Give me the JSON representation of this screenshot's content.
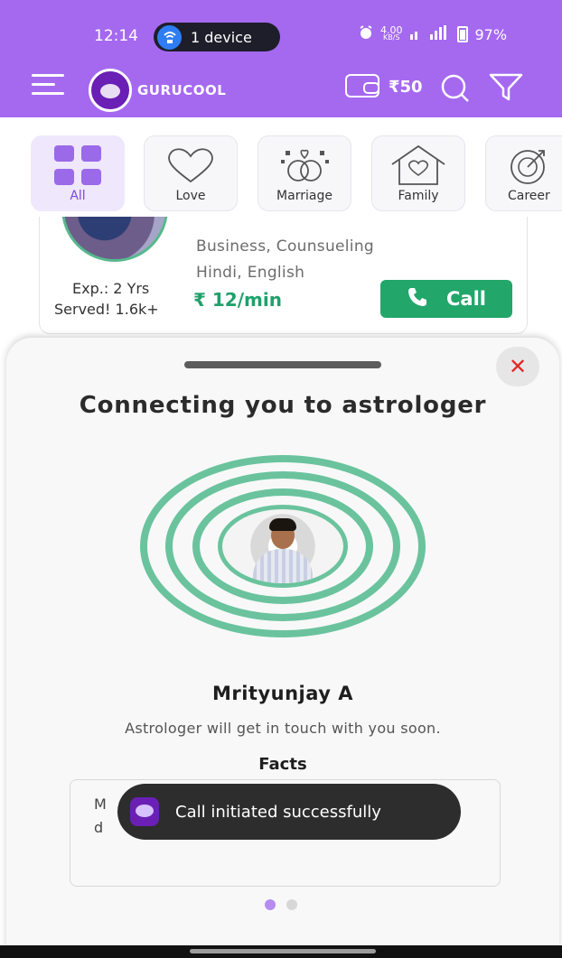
{
  "status": {
    "time": "12:14",
    "device_label": "1 device",
    "net_speed_top": "4.00",
    "net_speed_unit": "KB/S",
    "battery": "97%"
  },
  "appbar": {
    "brand": "GURUCOOL",
    "balance": "₹50"
  },
  "categories": [
    {
      "label": "All",
      "icon": "grid-icon",
      "active": true
    },
    {
      "label": "Love",
      "icon": "heart-icon"
    },
    {
      "label": "Marriage",
      "icon": "rings-icon"
    },
    {
      "label": "Family",
      "icon": "house-icon"
    },
    {
      "label": "Career",
      "icon": "career-icon"
    }
  ],
  "astrologer_card": {
    "skills": "Business, Counsueling",
    "languages": "Hindi, English",
    "experience": "Exp.: 2 Yrs",
    "served": "Served! 1.6k+",
    "price": "₹ 12/min",
    "call_label": "Call"
  },
  "sheet": {
    "title": "Connecting you to astrologer",
    "astrologer_name": "Mrityunjay A",
    "subtitle": "Astrologer will get in touch with you soon.",
    "facts_heading": "Facts",
    "facts_text_visible": "M\nd"
  },
  "toast": {
    "message": "Call initiated successfully"
  },
  "colors": {
    "brand_purple": "#a569f0",
    "call_green": "#23a66a",
    "ring_green": "#6ac39d",
    "close_red": "#e12828"
  }
}
